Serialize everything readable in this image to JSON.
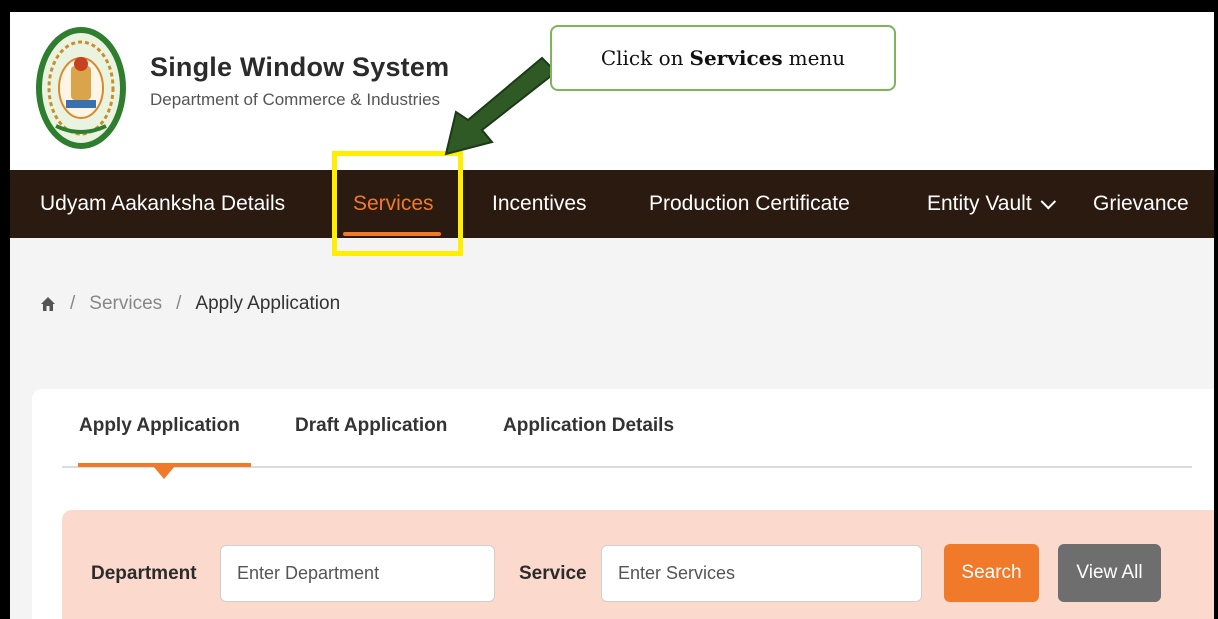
{
  "header": {
    "title": "Single Window System",
    "subtitle": "Department of Commerce & Industries"
  },
  "callout": {
    "prefix": "Click on",
    "emphasis": "Services",
    "suffix": "menu"
  },
  "nav": {
    "items": [
      {
        "label": "Udyam Aakanksha Details"
      },
      {
        "label": "Services"
      },
      {
        "label": "Incentives"
      },
      {
        "label": "Production Certificate"
      },
      {
        "label": "Entity Vault"
      },
      {
        "label": "Grievance"
      }
    ],
    "active": "Services"
  },
  "breadcrumb": {
    "sep": "/",
    "items": [
      "Services",
      "Apply Application"
    ]
  },
  "tabs": [
    "Apply Application",
    "Draft Application",
    "Application Details"
  ],
  "search": {
    "department_label": "Department",
    "department_placeholder": "Enter Department",
    "service_label": "Service",
    "service_placeholder": "Enter Services",
    "search_button": "Search",
    "viewall_button": "View All"
  },
  "colors": {
    "accent": "#f07a2a",
    "nav_bg": "#2b1a0f",
    "highlight": "#ffee00",
    "arrow": "#2f5a25",
    "panel": "#fbd9cc"
  },
  "icons": {
    "home": "home-icon",
    "chevron": "chevron-down-icon",
    "emblem": "state-emblem"
  }
}
